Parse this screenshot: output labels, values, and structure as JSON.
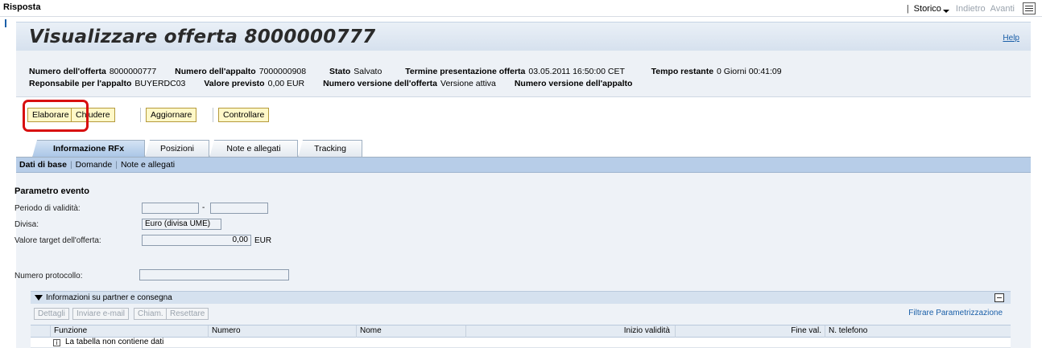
{
  "topbar": {
    "title": "Risposta",
    "history": "Storico",
    "back": "Indietro",
    "forward": "Avanti"
  },
  "header": {
    "title": "Visualizzare offerta 8000000777",
    "help": "Help"
  },
  "info": {
    "bid_number_label": "Numero dell'offerta",
    "bid_number": "8000000777",
    "tender_number_label": "Numero dell'appalto",
    "tender_number": "7000000908",
    "status_label": "Stato",
    "status": "Salvato",
    "deadline_label": "Termine presentazione offerta",
    "deadline": "03.05.2011 16:50:00 CET",
    "remaining_label": "Tempo restante",
    "remaining": "0 Giorni 00:41:09",
    "responsible_label": "Reponsabile per l'appalto",
    "responsible": "BUYERDC03",
    "expected_value_label": "Valore previsto",
    "expected_value": "0,00 EUR",
    "bid_version_label": "Numero versione dell'offerta",
    "bid_version": "Versione attiva",
    "tender_version_label": "Numero versione dell'appalto"
  },
  "toolbar": {
    "edit": "Elaborare",
    "close": "Chiudere",
    "update": "Aggiornare",
    "check": "Controllare"
  },
  "tabs": [
    "Informazione RFx",
    "Posizioni",
    "Note e allegati",
    "Tracking"
  ],
  "subnav": [
    "Dati di base",
    "Domande",
    "Note e allegati"
  ],
  "form": {
    "section": "Parametro evento",
    "validity_label": "Periodo di validità:",
    "validity_from": "",
    "validity_to": "",
    "dash": "-",
    "currency_label": "Divisa:",
    "currency": "Euro (divisa UME)",
    "target_label": "Valore target dell'offerta:",
    "target_value": "0,00",
    "target_unit": "EUR",
    "protocol_label": "Numero protocollo:",
    "protocol_value": ""
  },
  "partners": {
    "title": "Informazioni su partner e consegna",
    "buttons": [
      "Dettagli",
      "Inviare e-mail",
      "Chiam.",
      "Resettare"
    ],
    "filter": "Filtrare",
    "settings": "Parametrizzazione",
    "columns": [
      "Funzione",
      "Numero",
      "Nome",
      "Inizio validità",
      "Fine val.",
      "N. telefono"
    ],
    "empty_text": "La tabella non contiene dati"
  }
}
